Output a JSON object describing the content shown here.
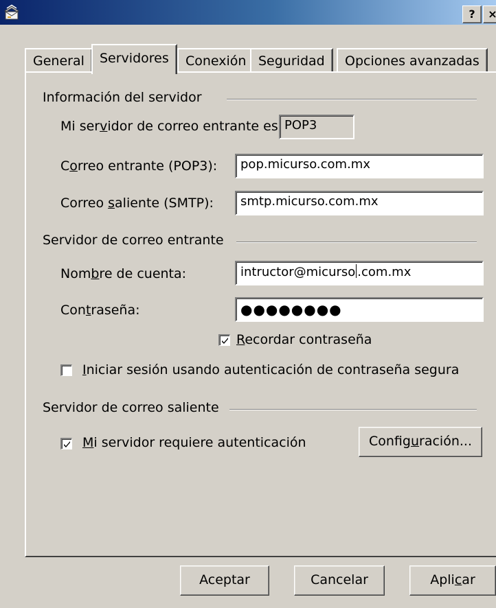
{
  "titlebar": {
    "icon": "mail-account-icon",
    "help_label": "?",
    "close_label": "×"
  },
  "tabs": [
    {
      "label": "General",
      "active": false
    },
    {
      "label": "Servidores",
      "active": true
    },
    {
      "label": "Conexión",
      "active": false
    },
    {
      "label": "Seguridad",
      "active": false
    },
    {
      "label": "Opciones avanzadas",
      "active": false
    }
  ],
  "server_info": {
    "group_label": "Información del servidor",
    "incoming_type_label": {
      "pre": "Mi ser",
      "mn": "v",
      "post": "idor de correo entrante es"
    },
    "incoming_type_value": "POP3",
    "incoming_label": {
      "pre": "C",
      "mn": "o",
      "post": "rreo entrante (POP3):"
    },
    "incoming_value": "pop.micurso.com.mx",
    "outgoing_label": {
      "pre": "Correo ",
      "mn": "s",
      "post": "aliente (SMTP):"
    },
    "outgoing_value": "smtp.micurso.com.mx"
  },
  "incoming_server": {
    "group_label": "Servidor de correo entrante",
    "account_label": {
      "pre": "Nom",
      "mn": "b",
      "post": "re de cuenta:"
    },
    "account_value_before_caret": "intructor@micurso",
    "account_value_after_caret": ".com.mx",
    "password_label": {
      "pre": "Con",
      "mn": "t",
      "post": "raseña:"
    },
    "password_mask": "●●●●●●●●",
    "remember_checked": true,
    "remember_label": {
      "pre": "",
      "mn": "R",
      "post": "ecordar contraseña"
    },
    "spa_checked": false,
    "spa_label": {
      "pre": "",
      "mn": "I",
      "post": "niciar sesión usando autenticación de contraseña segura"
    }
  },
  "outgoing_server": {
    "group_label": "Servidor de correo saliente",
    "auth_checked": true,
    "auth_label": {
      "pre": "",
      "mn": "M",
      "post": "i servidor requiere autenticación"
    },
    "settings_button": {
      "pre": "Config",
      "mn": "u",
      "post": "ración..."
    }
  },
  "footer": {
    "accept_label": "Aceptar",
    "cancel_label": "Cancelar",
    "apply_label": {
      "pre": "Apli",
      "mn": "c",
      "post": "ar"
    }
  },
  "colors": {
    "titlebar_start": "#0a246a",
    "titlebar_end": "#a6caf0",
    "face": "#d4d0c8"
  }
}
